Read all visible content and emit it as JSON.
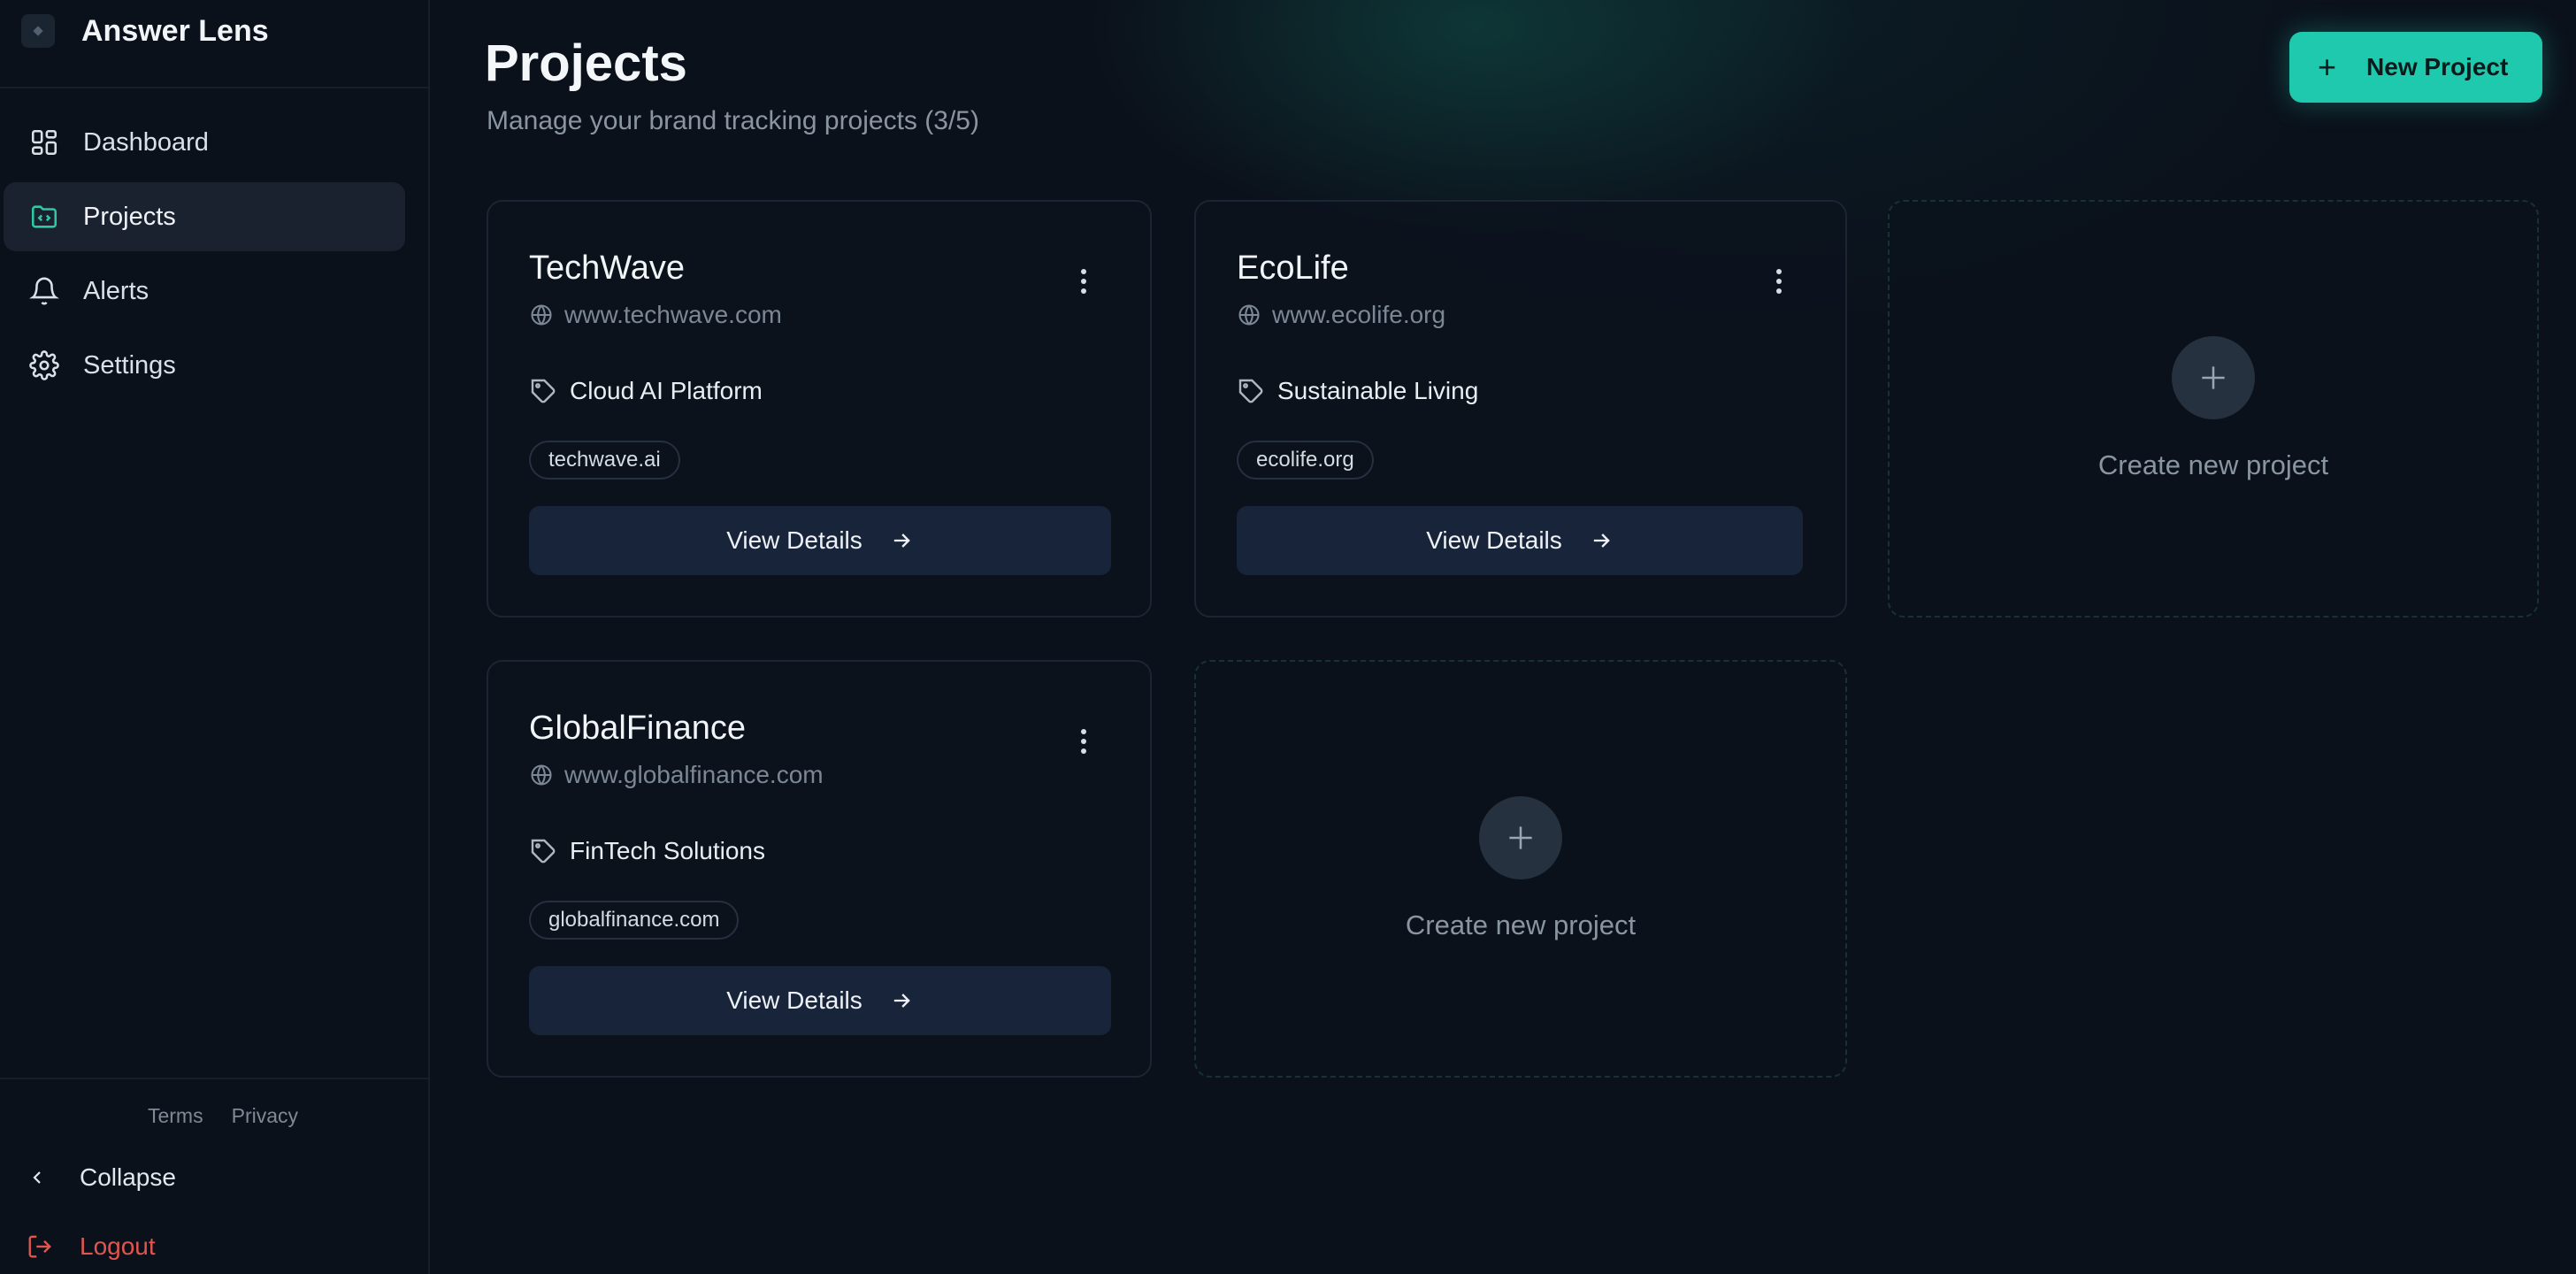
{
  "app": {
    "name": "Answer Lens"
  },
  "sidebar": {
    "items": [
      {
        "label": "Dashboard",
        "icon": "dashboard-grid-icon",
        "active": false
      },
      {
        "label": "Projects",
        "icon": "folder-code-icon",
        "active": true
      },
      {
        "label": "Alerts",
        "icon": "bell-icon",
        "active": false
      },
      {
        "label": "Settings",
        "icon": "gear-icon",
        "active": false
      }
    ],
    "footer": {
      "terms": "Terms",
      "privacy": "Privacy",
      "collapse": "Collapse",
      "logout": "Logout"
    }
  },
  "header": {
    "title": "Projects",
    "subtitle": "Manage your brand tracking projects (3/5)",
    "new_project": "New Project"
  },
  "projects": [
    {
      "name": "TechWave",
      "url": "www.techwave.com",
      "category": "Cloud AI Platform",
      "domain": "techwave.ai",
      "action": "View Details"
    },
    {
      "name": "EcoLife",
      "url": "www.ecolife.org",
      "category": "Sustainable Living",
      "domain": "ecolife.org",
      "action": "View Details"
    },
    {
      "name": "GlobalFinance",
      "url": "www.globalfinance.com",
      "category": "FinTech Solutions",
      "domain": "globalfinance.com",
      "action": "View Details"
    }
  ],
  "create_slots": [
    {
      "label": "Create new project"
    },
    {
      "label": "Create new project"
    }
  ],
  "colors": {
    "accent": "#1fc9ae",
    "background": "#0b111b",
    "logout": "#e0564f"
  }
}
